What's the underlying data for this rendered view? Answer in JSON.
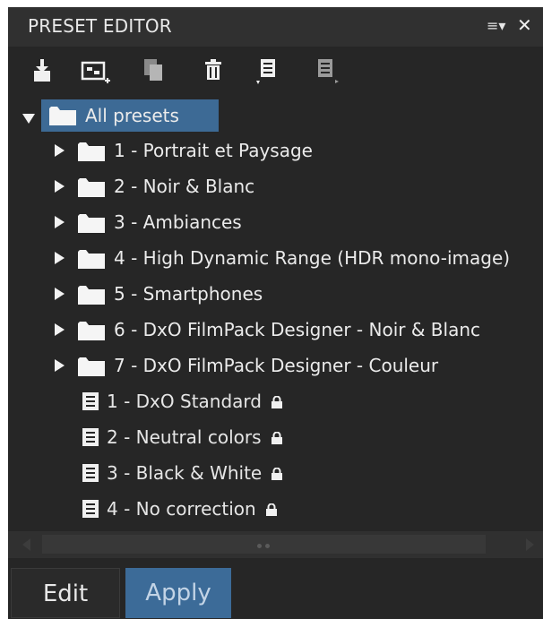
{
  "panel": {
    "title": "PRESET EDITOR",
    "menu_icon": "≡▾",
    "close_icon": "✕"
  },
  "toolbar": {
    "buttons": [
      {
        "name": "import-preset-icon"
      },
      {
        "name": "new-preset-from-settings-icon"
      },
      {
        "name": "duplicate-preset-icon"
      },
      {
        "name": "delete-preset-icon"
      },
      {
        "name": "export-preset-icon"
      },
      {
        "name": "export-preset-disabled-icon"
      }
    ]
  },
  "tree": {
    "root": {
      "label": "All presets",
      "expanded": true,
      "selected": true
    },
    "folders": [
      {
        "label": "1 - Portrait et Paysage"
      },
      {
        "label": "2 - Noir & Blanc"
      },
      {
        "label": "3 - Ambiances"
      },
      {
        "label": "4 - High Dynamic Range (HDR mono-image)"
      },
      {
        "label": "5 - Smartphones"
      },
      {
        "label": "6 - DxO FilmPack Designer - Noir & Blanc"
      },
      {
        "label": "7 - DxO FilmPack Designer - Couleur"
      }
    ],
    "presets": [
      {
        "label": "1 - DxO Standard",
        "locked": true
      },
      {
        "label": "2 - Neutral colors",
        "locked": true
      },
      {
        "label": "3 - Black & White",
        "locked": true
      },
      {
        "label": "4 - No correction",
        "locked": true
      }
    ]
  },
  "footer": {
    "edit_label": "Edit",
    "apply_label": "Apply"
  },
  "colors": {
    "selection": "#3d6a95",
    "apply_button": "#3c6b98",
    "panel_bg": "#262626"
  }
}
